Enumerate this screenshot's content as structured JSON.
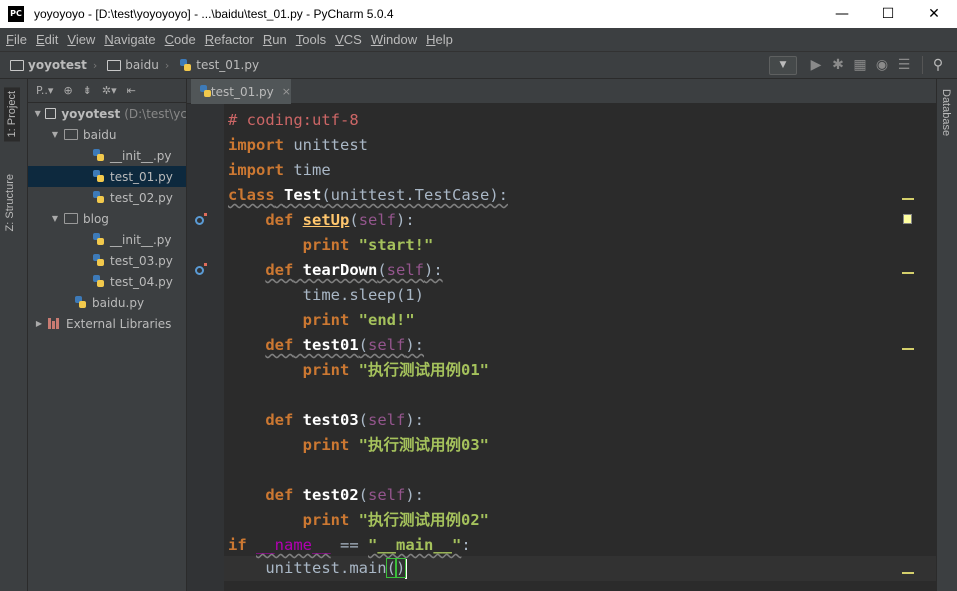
{
  "window": {
    "app_icon": "PC",
    "title": "yoyoyoyo - [D:\\test\\yoyoyoyo] - ...\\baidu\\test_01.py - PyCharm 5.0.4",
    "minimize": "—",
    "maximize": "☐",
    "close": "✕"
  },
  "menu": [
    "File",
    "Edit",
    "View",
    "Navigate",
    "Code",
    "Refactor",
    "Run",
    "Tools",
    "VCS",
    "Window",
    "Help"
  ],
  "breadcrumb": [
    "yoyotest",
    "baidu",
    "test_01.py"
  ],
  "project_panel": {
    "header_label": "P..▾",
    "tree": [
      {
        "label": "yoyotest",
        "path": "(D:\\test\\yc",
        "type": "folder-root",
        "indent": 0,
        "expanded": true
      },
      {
        "label": "baidu",
        "type": "folder",
        "indent": 1,
        "expanded": true
      },
      {
        "label": "__init__.py",
        "type": "py",
        "indent": 2
      },
      {
        "label": "test_01.py",
        "type": "py",
        "indent": 2,
        "selected": true
      },
      {
        "label": "test_02.py",
        "type": "py",
        "indent": 2
      },
      {
        "label": "blog",
        "type": "folder",
        "indent": 1,
        "expanded": true
      },
      {
        "label": "__init__.py",
        "type": "py",
        "indent": 2
      },
      {
        "label": "test_03.py",
        "type": "py",
        "indent": 2
      },
      {
        "label": "test_04.py",
        "type": "py",
        "indent": 2
      },
      {
        "label": "baidu.py",
        "type": "py",
        "indent": 1
      },
      {
        "label": "External Libraries",
        "type": "lib",
        "indent": 0,
        "expanded": false
      }
    ]
  },
  "left_tabs": {
    "project": "1: Project",
    "structure": "Z: Structure"
  },
  "right_tabs": {
    "database": "Database"
  },
  "editor_tab": {
    "label": "test_01.py",
    "close": "×"
  },
  "code": {
    "l1": "# coding:utf-8",
    "l2_kw": "import",
    "l2_rest": " unittest",
    "l3_kw": "import",
    "l3_rest": " time",
    "l4_kw": "class",
    "l4_name": "Test",
    "l4_rest": "(unittest.TestCase):",
    "l5_kw": "def",
    "l5_name": "setUp",
    "l5_self": "self",
    "l6_kw": "print",
    "l6_str": "\"start!\"",
    "l7_kw": "def",
    "l7_name": "tearDown",
    "l7_self": "self",
    "l8": "time.sleep(1)",
    "l9_kw": "print",
    "l9_str": "\"end!\"",
    "l10_kw": "def",
    "l10_name": "test01",
    "l10_self": "self",
    "l11_kw": "print",
    "l11_str": "\"执行测试用例01\"",
    "l13_kw": "def",
    "l13_name": "test03",
    "l13_self": "self",
    "l14_kw": "print",
    "l14_str": "\"执行测试用例03\"",
    "l16_kw": "def",
    "l16_name": "test02",
    "l16_self": "self",
    "l17_kw": "print",
    "l17_str": "\"执行测试用例02\"",
    "l18_kw": "if",
    "l18_magic": "__name__",
    "l18_str": "\"__main__\"",
    "l19": "unittest.main"
  }
}
